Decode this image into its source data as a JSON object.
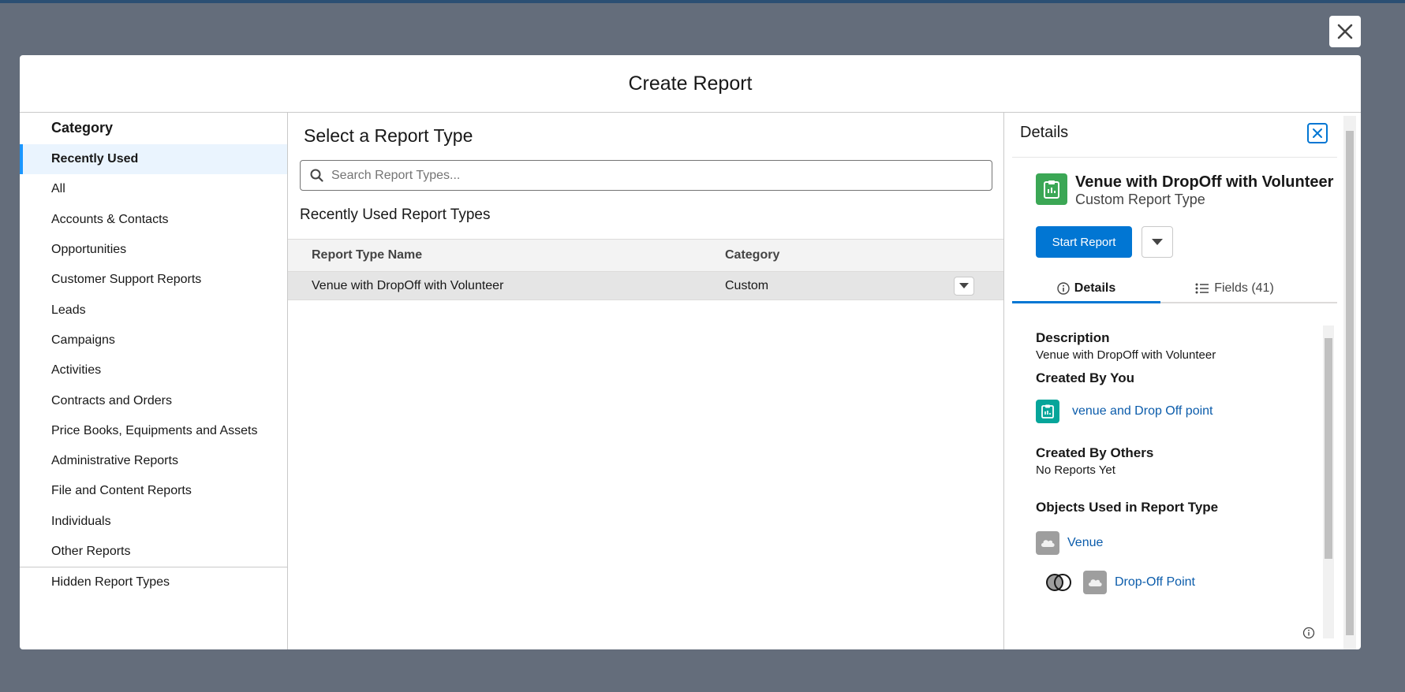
{
  "modal": {
    "title": "Create Report"
  },
  "category": {
    "heading": "Category",
    "items": [
      {
        "label": "Recently Used",
        "active": true
      },
      {
        "label": "All"
      },
      {
        "label": "Accounts & Contacts"
      },
      {
        "label": "Opportunities"
      },
      {
        "label": "Customer Support Reports"
      },
      {
        "label": "Leads"
      },
      {
        "label": "Campaigns"
      },
      {
        "label": "Activities"
      },
      {
        "label": "Contracts and Orders"
      },
      {
        "label": "Price Books, Equipments and Assets"
      },
      {
        "label": "Administrative Reports"
      },
      {
        "label": "File and Content Reports"
      },
      {
        "label": "Individuals"
      },
      {
        "label": "Other Reports"
      }
    ],
    "hidden": "Hidden Report Types"
  },
  "main": {
    "title": "Select a Report Type",
    "search_placeholder": "Search Report Types...",
    "recent_title": "Recently Used Report Types",
    "columns": [
      "Report Type Name",
      "Category"
    ],
    "rows": [
      {
        "name": "Venue with DropOff with Volunteer",
        "category": "Custom"
      }
    ]
  },
  "details": {
    "heading": "Details",
    "report_name": "Venue with DropOff with Volunteer",
    "report_kind": "Custom Report Type",
    "start_button": "Start Report",
    "tabs": {
      "details": "Details",
      "fields": "Fields (41)"
    },
    "description_label": "Description",
    "description": "Venue with DropOff with Volunteer",
    "created_by_you_label": "Created By You",
    "created_by_you_link": "venue and Drop Off point",
    "created_by_others_label": "Created By Others",
    "created_by_others_text": "No Reports Yet",
    "objects_label": "Objects Used in Report Type",
    "objects": [
      "Venue",
      "Drop-Off Point"
    ]
  },
  "colors": {
    "brand": "#0176d3",
    "report_icon": "#3ba755",
    "overlay": "#646d7b"
  }
}
